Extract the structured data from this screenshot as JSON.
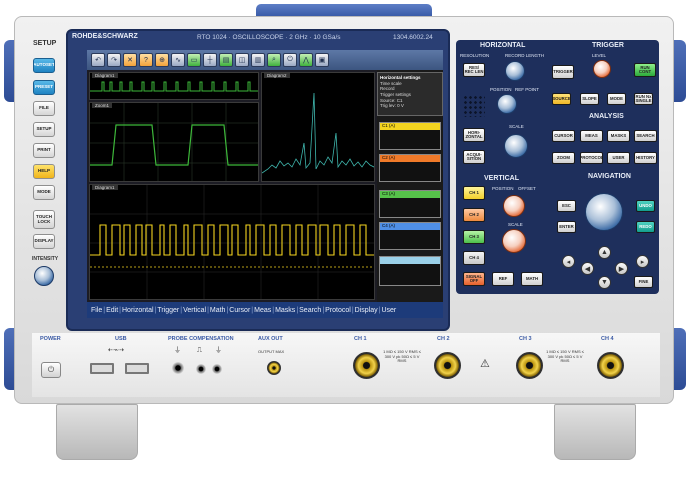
{
  "header": {
    "brand": "ROHDE&SCHWARZ",
    "model": "RTO 1024 · OSCILLOSCOPE · 2 GHz · 10 GSa/s",
    "serial": "1304.6002.24"
  },
  "left_keys": {
    "title": "SETUP",
    "keys": [
      "AUTOSET",
      "PRESET",
      "FILE",
      "SETUP",
      "PRINT",
      "HELP",
      "MODE",
      "TOUCH LOCK",
      "DISPLAY"
    ],
    "intensity_label": "INTENSITY"
  },
  "screen": {
    "toolbar_icons": [
      "undo-icon",
      "redo-icon",
      "clear-icon",
      "help-icon",
      "zoom-icon",
      "fft-icon",
      "meas-icon",
      "cursor-icon",
      "mask-icon",
      "ref-icon",
      "histogram-icon",
      "search-icon",
      "power-icon",
      "spectrum-icon",
      "record-icon"
    ],
    "diagrams": [
      "Diagram1",
      "Diagram2",
      "Zoom1",
      "Diagram1"
    ],
    "horizontal_settings": {
      "title": "Horizontal settings",
      "rows": [
        "Time scale",
        "Record",
        "Trigger settings",
        "Source: C1",
        "Trig lev: 0 V"
      ]
    },
    "channel_boxes": [
      {
        "label": "C1 (A)",
        "color": "#f3d41f"
      },
      {
        "label": "C2 (A)",
        "color": "#f07a29"
      },
      {
        "label": "C3 (A)",
        "color": "#56c24a"
      },
      {
        "label": "C4 (A)",
        "color": "#4f8fe6"
      }
    ],
    "menu": [
      "File",
      "Edit",
      "Horizontal",
      "Trigger",
      "Vertical",
      "Math",
      "Cursor",
      "Meas",
      "Masks",
      "Search",
      "Protocol",
      "Display",
      "User"
    ]
  },
  "horizontal": {
    "title": "HORIZONTAL",
    "resolution_label": "RESOLUTION",
    "record_length_label": "RECORD LENGTH",
    "res_rec_len": "RES/ REC LEN",
    "position_label": "POSITION",
    "ref_point_label": "REF POINT",
    "scale_label": "SCALE",
    "horizontal_key": "HORI- ZONTAL",
    "acquisition_key": "ACQUI- SITION"
  },
  "trigger": {
    "title": "TRIGGER",
    "level_label": "LEVEL",
    "keys": [
      "TRIGGER",
      "RUN CONT",
      "SOURCE",
      "SLOPE",
      "MODE",
      "RUN Nx SINGLE"
    ]
  },
  "analysis": {
    "title": "ANALYSIS",
    "keys": [
      "CURSOR",
      "MEAS",
      "MASKS",
      "SEARCH",
      "ZOOM",
      "PROTOCOL",
      "USER",
      "HISTORY"
    ]
  },
  "vertical": {
    "title": "VERTICAL",
    "position_label": "POSITION",
    "offset_label": "OFFSET",
    "scale_label": "SCALE",
    "channel_keys": [
      "CH 1",
      "CH 2",
      "CH 3",
      "CH 4"
    ],
    "signal_off": "SIGNAL OFF",
    "ref": "REF",
    "math": "MATH"
  },
  "navigation": {
    "title": "NAVIGATION",
    "keys": [
      "ESC",
      "ENTER",
      "UNDO",
      "REDO",
      "FINE"
    ]
  },
  "front": {
    "power": "POWER",
    "usb": "USB",
    "probe_comp": "PROBE COMPENSATION",
    "aux_out": "AUX OUT",
    "aux_sub": "OUTPUT MAX",
    "channels": [
      "CH 1",
      "CH 2",
      "CH 3",
      "CH 4"
    ],
    "impedance": "1 MΩ ≤ 150 V RMS ≤ 300 V pk  50Ω ≤ 5 V RMS",
    "warning": "⚠"
  },
  "colors": {
    "bezel": "#2a3f74",
    "menu_bar": "#1d3b7a",
    "ch1": "#f3d41f",
    "ch2": "#f07a29",
    "ch3": "#56c24a",
    "ch4": "#4f8fe6",
    "panel": "#1e2f5c"
  }
}
